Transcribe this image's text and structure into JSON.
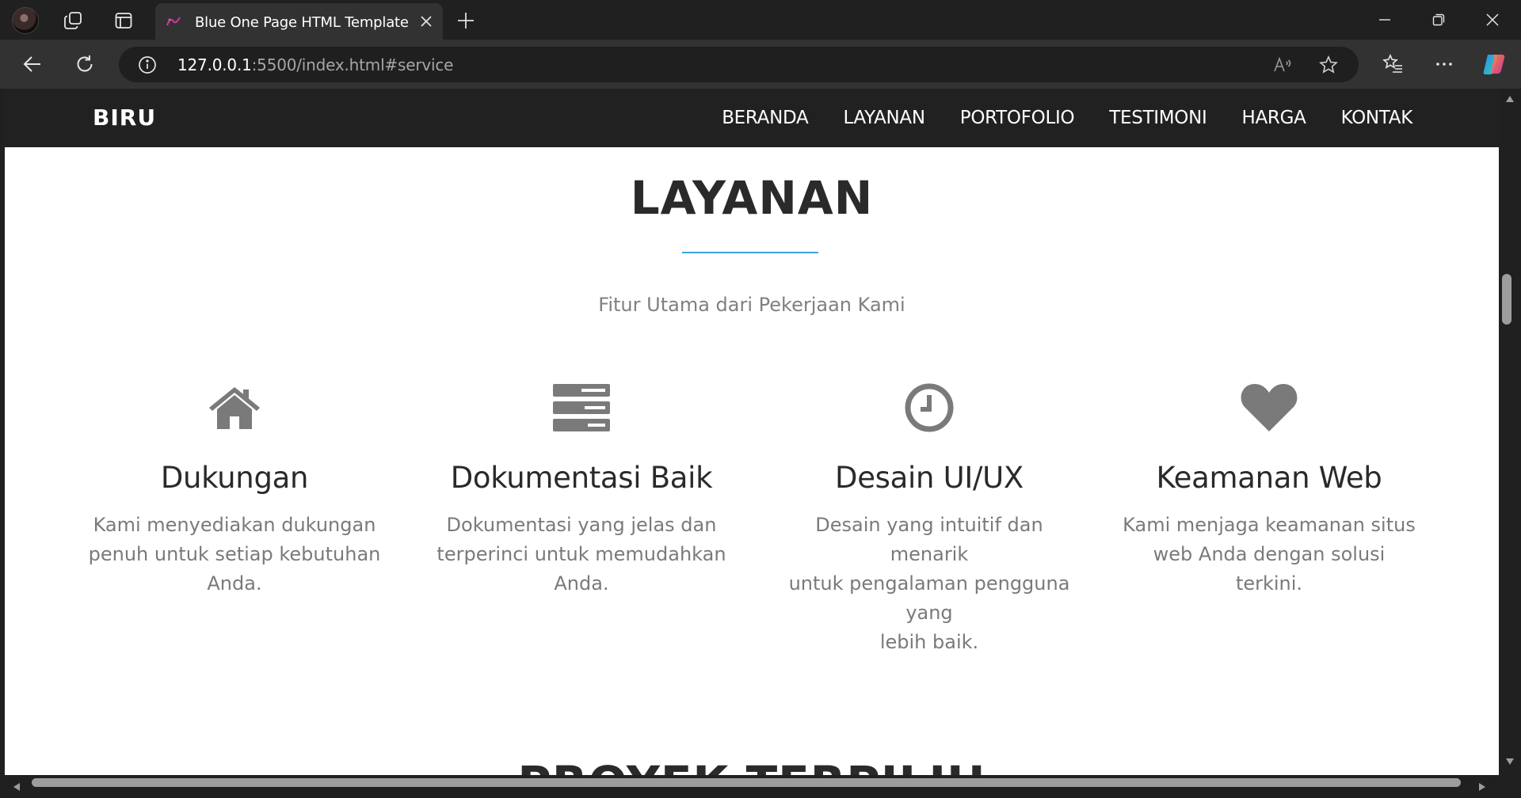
{
  "browser": {
    "tab_title": "Blue One Page HTML Template",
    "url_host": "127.0.0.1",
    "url_rest": ":5500/index.html#service"
  },
  "site": {
    "brand": "BIRU",
    "menu": [
      "BERANDA",
      "LAYANAN",
      "PORTOFOLIO",
      "TESTIMONI",
      "HARGA",
      "KONTAK"
    ]
  },
  "section": {
    "title": "LAYANAN",
    "subtitle": "Fitur Utama dari Pekerjaan Kami",
    "accent_color": "#3aa3e3",
    "features": [
      {
        "icon": "home-icon",
        "title": "Dukungan",
        "lines": [
          "Kami menyediakan dukungan",
          "penuh untuk setiap kebutuhan",
          "Anda."
        ]
      },
      {
        "icon": "server-icon",
        "title": "Dokumentasi Baik",
        "lines": [
          "Dokumentasi yang jelas dan",
          "terperinci untuk memudahkan",
          "Anda."
        ]
      },
      {
        "icon": "clock-icon",
        "title": "Desain UI/UX",
        "lines": [
          "Desain yang intuitif dan menarik",
          "untuk pengalaman pengguna yang",
          "lebih baik."
        ]
      },
      {
        "icon": "heart-icon",
        "title": "Keamanan Web",
        "lines": [
          "Kami menjaga keamanan situs",
          "web Anda dengan solusi terkini."
        ]
      }
    ],
    "next_title": "PROYEK TERPILIH"
  }
}
